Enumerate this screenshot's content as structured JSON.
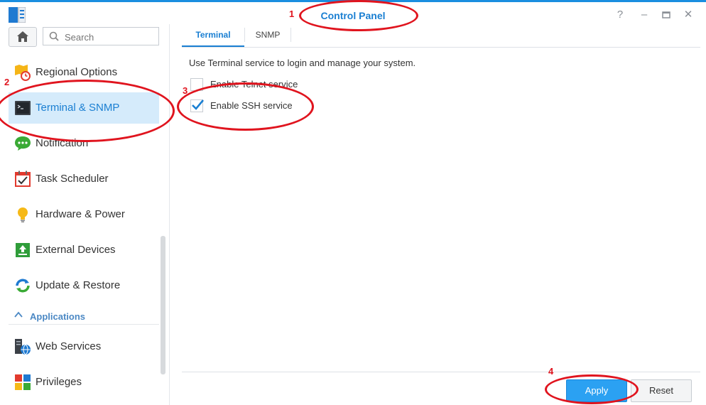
{
  "window": {
    "title": "Control Panel",
    "help_icon": "help-icon",
    "minimize_icon": "minimize-icon",
    "maximize_icon": "maximize-icon",
    "close_icon": "close-icon"
  },
  "sidebar": {
    "search_placeholder": "Search",
    "items": [
      {
        "label": "Regional Options",
        "icon": "regional-options-icon",
        "active": false
      },
      {
        "label": "Terminal & SNMP",
        "icon": "terminal-icon",
        "active": true
      },
      {
        "label": "Notification",
        "icon": "notification-icon",
        "active": false
      },
      {
        "label": "Task Scheduler",
        "icon": "task-scheduler-icon",
        "active": false
      },
      {
        "label": "Hardware & Power",
        "icon": "hardware-power-icon",
        "active": false
      },
      {
        "label": "External Devices",
        "icon": "external-devices-icon",
        "active": false
      },
      {
        "label": "Update & Restore",
        "icon": "update-restore-icon",
        "active": false
      }
    ],
    "section_label": "Applications",
    "app_items": [
      {
        "label": "Web Services",
        "icon": "web-services-icon"
      },
      {
        "label": "Privileges",
        "icon": "privileges-icon"
      }
    ]
  },
  "tabs": [
    {
      "label": "Terminal",
      "active": true
    },
    {
      "label": "SNMP",
      "active": false
    }
  ],
  "content": {
    "description": "Use Terminal service to login and manage your system.",
    "telnet_label": "Enable Telnet service",
    "telnet_checked": false,
    "ssh_label": "Enable SSH service",
    "ssh_checked": true
  },
  "footer": {
    "apply_label": "Apply",
    "reset_label": "Reset"
  },
  "annotations": [
    "1",
    "2",
    "3",
    "4"
  ],
  "colors": {
    "accent": "#1a7fd2",
    "active_bg": "#d5ebfb",
    "apply_bg": "#2ba1f2",
    "annotation": "#e0141e"
  }
}
